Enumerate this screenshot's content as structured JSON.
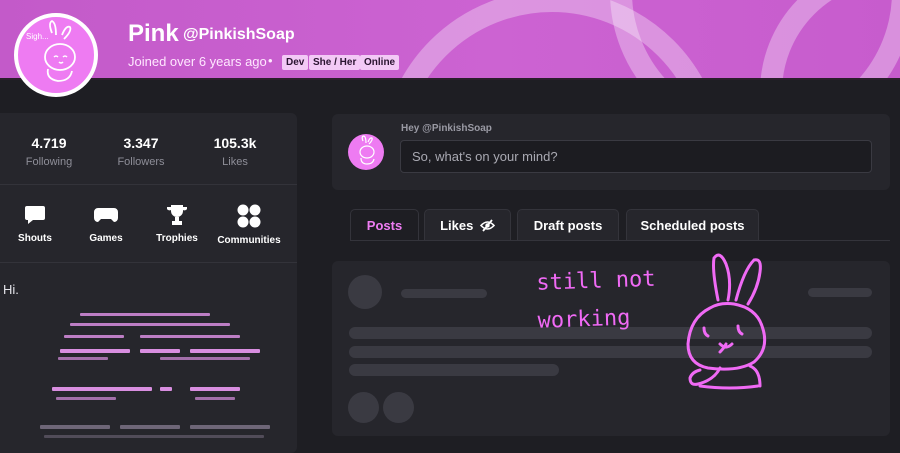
{
  "profile": {
    "name": "Pink",
    "handle": "@PinkishSoap",
    "joined": "Joined over 6 years ago",
    "separator": "•",
    "badges": [
      "Dev",
      "She / Her",
      "Online"
    ],
    "avatar_caption": "Sigh..."
  },
  "stats": [
    {
      "value": "4.719",
      "label": "Following"
    },
    {
      "value": "3.347",
      "label": "Followers"
    },
    {
      "value": "105.3k",
      "label": "Likes"
    }
  ],
  "nav": [
    {
      "label": "Shouts",
      "icon": "speech-bubble-icon"
    },
    {
      "label": "Games",
      "icon": "gamepad-icon"
    },
    {
      "label": "Trophies",
      "icon": "trophy-icon"
    },
    {
      "label": "Communities",
      "icon": "communities-icon"
    }
  ],
  "bio": {
    "text": "Hi."
  },
  "composer": {
    "greeting": "Hey @PinkishSoap",
    "placeholder": "So, what's on your mind?"
  },
  "tabs": [
    {
      "label": "Posts",
      "active": true
    },
    {
      "label": "Likes",
      "icon": "eye-off-icon",
      "active": false
    },
    {
      "label": "Draft posts",
      "active": false
    },
    {
      "label": "Scheduled posts",
      "active": false
    }
  ],
  "doodle": {
    "text_line1": "still not",
    "text_line2": "working"
  },
  "colors": {
    "accent": "#ef7df3",
    "header": "#c95fcf",
    "background": "#1e1e23",
    "panel": "#26262c",
    "doodle": "#f06af5"
  }
}
